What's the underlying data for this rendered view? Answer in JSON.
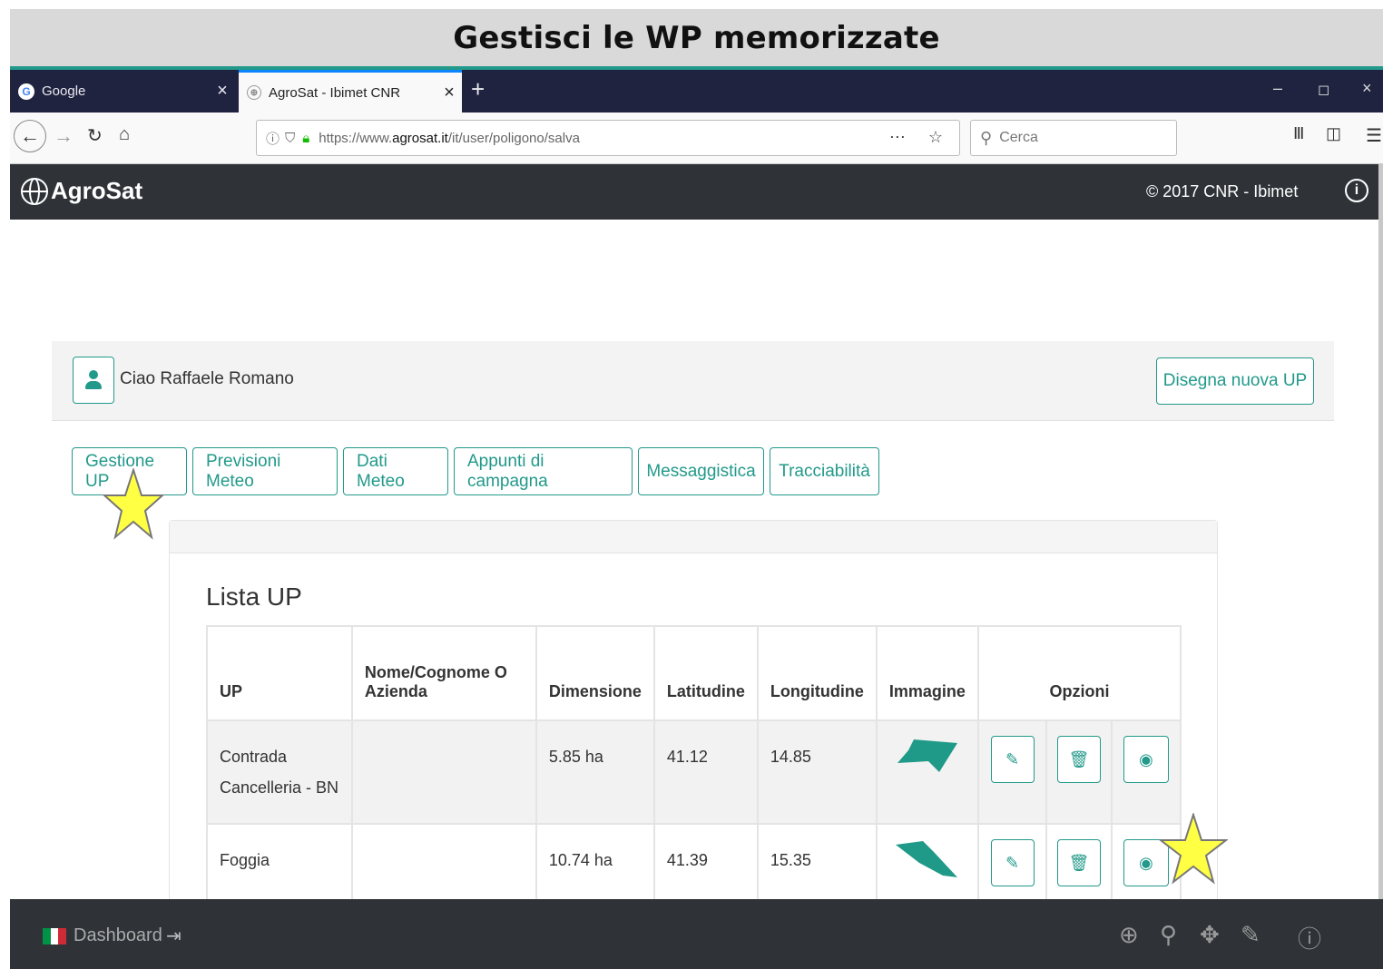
{
  "caption": "Gestisci le WP memorizzate",
  "browser": {
    "tabs": [
      {
        "title": "Google"
      },
      {
        "title": "AgroSat - Ibimet CNR"
      }
    ],
    "url_prefix": "https://www.",
    "url_domain": "agrosat.it",
    "url_path": "/it/user/poligono/salva",
    "search_placeholder": "Cerca"
  },
  "app": {
    "brand": "AgroSat",
    "copyright": "© 2017 CNR - Ibimet"
  },
  "user": {
    "greeting": "Ciao Raffaele Romano",
    "new_up_label": "Disegna nuova UP"
  },
  "nav_tabs": [
    "Gestione UP",
    "Previsioni Meteo",
    "Dati Meteo",
    "Appunti di campagna",
    "Messaggistica",
    "Tracciabilità"
  ],
  "list": {
    "title": "Lista UP",
    "headers": [
      "UP",
      "Nome/Cognome O Azienda",
      "Dimensione",
      "Latitudine",
      "Longitudine",
      "Immagine",
      "Opzioni"
    ],
    "rows": [
      {
        "up": "Contrada Cancelleria - BN",
        "name": "",
        "size": "5.85 ha",
        "lat": "41.12",
        "lon": "14.85"
      },
      {
        "up": "Foggia",
        "name": "",
        "size": "10.74 ha",
        "lat": "41.39",
        "lon": "15.35"
      }
    ]
  },
  "footer": {
    "dashboard_label": "Dashboard",
    "icons": [
      "crosshair-icon",
      "zoom-icon",
      "move-icon",
      "edit-icon",
      "help-icon"
    ]
  },
  "colors": {
    "accent": "#22998a",
    "header_bg": "#2f3338",
    "browser_tab_bg": "#202340",
    "highlight_star": "#ffff44"
  }
}
